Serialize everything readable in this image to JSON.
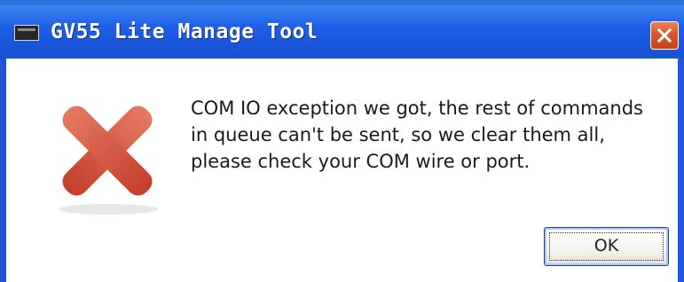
{
  "window": {
    "title": "GV55 Lite Manage Tool"
  },
  "dialog": {
    "message_lines": [
      "COM IO exception we got, the rest of commands",
      "in queue can't be sent, so we clear them all,",
      "please check your COM wire or port."
    ],
    "ok_label": "OK"
  },
  "icons": {
    "app": "console-window-icon",
    "error": "error-x-icon",
    "close": "close-icon"
  },
  "colors": {
    "titlebar": "#1f5fe6",
    "close_button": "#d9562d",
    "error_icon": "#d04a36"
  }
}
